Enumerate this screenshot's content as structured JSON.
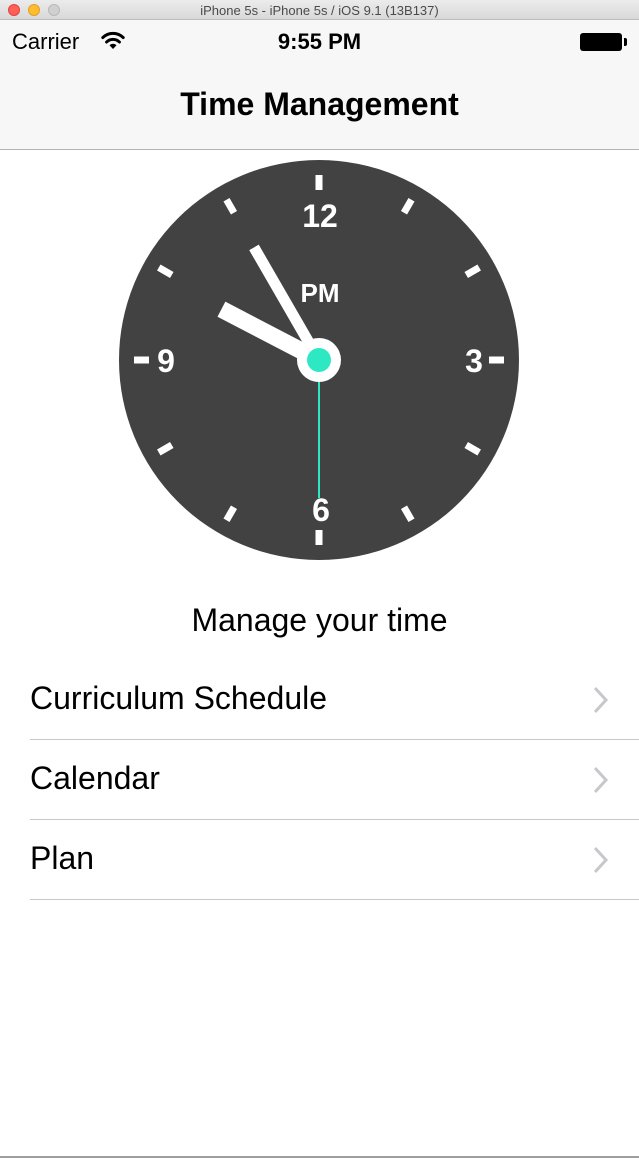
{
  "window": {
    "title": "iPhone 5s - iPhone 5s / iOS 9.1 (13B137)"
  },
  "status_bar": {
    "carrier": "Carrier",
    "time": "9:55 PM",
    "wifi_icon": "wifi-icon",
    "battery_icon": "battery-icon"
  },
  "nav": {
    "title": "Time Management"
  },
  "clock": {
    "numerals": {
      "twelve": "12",
      "three": "3",
      "six": "6",
      "nine": "9"
    },
    "period": "PM",
    "hour": 9,
    "minute": 55,
    "second": 30,
    "colors": {
      "face": "#424242",
      "marks": "#ffffff",
      "accent": "#2ee8c4"
    }
  },
  "tagline": "Manage your time",
  "menu": {
    "items": [
      {
        "label": "Curriculum Schedule"
      },
      {
        "label": "Calendar"
      },
      {
        "label": "Plan"
      }
    ],
    "chevron_icon": "chevron-right-icon"
  }
}
